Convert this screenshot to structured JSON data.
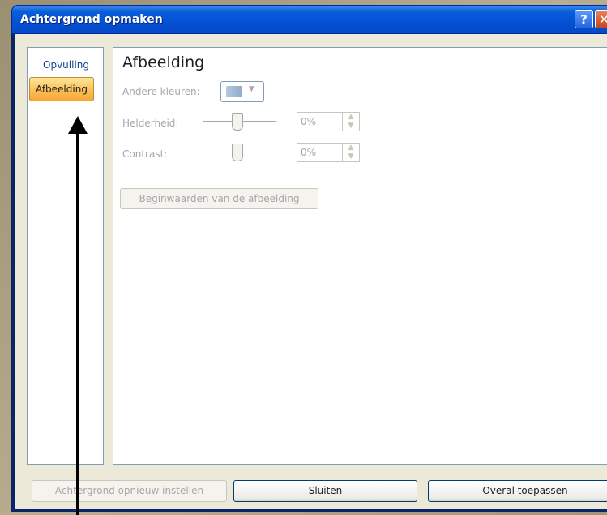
{
  "window": {
    "title": "Achtergrond opmaken",
    "help_glyph": "?",
    "close_glyph": "✕"
  },
  "nav": {
    "items": [
      {
        "label": "Opvulling"
      },
      {
        "label": "Afbeelding"
      }
    ]
  },
  "content": {
    "title": "Afbeelding",
    "other_colors_label": "Andere kleuren:",
    "brightness": {
      "label": "Helderheid:",
      "value": "0%"
    },
    "contrast": {
      "label": "Contrast:",
      "value": "0%"
    },
    "reset_picture_label": "Beginwaarden van de afbeelding"
  },
  "footer": {
    "reset_background_label": "Achtergrond opnieuw instellen",
    "close_label": "Sluiten",
    "apply_all_label": "Overal toepassen"
  },
  "icons": [
    "help-icon",
    "close-icon",
    "paint-bucket-icon",
    "chevron-down-icon",
    "spin-up-icon",
    "spin-down-icon"
  ]
}
